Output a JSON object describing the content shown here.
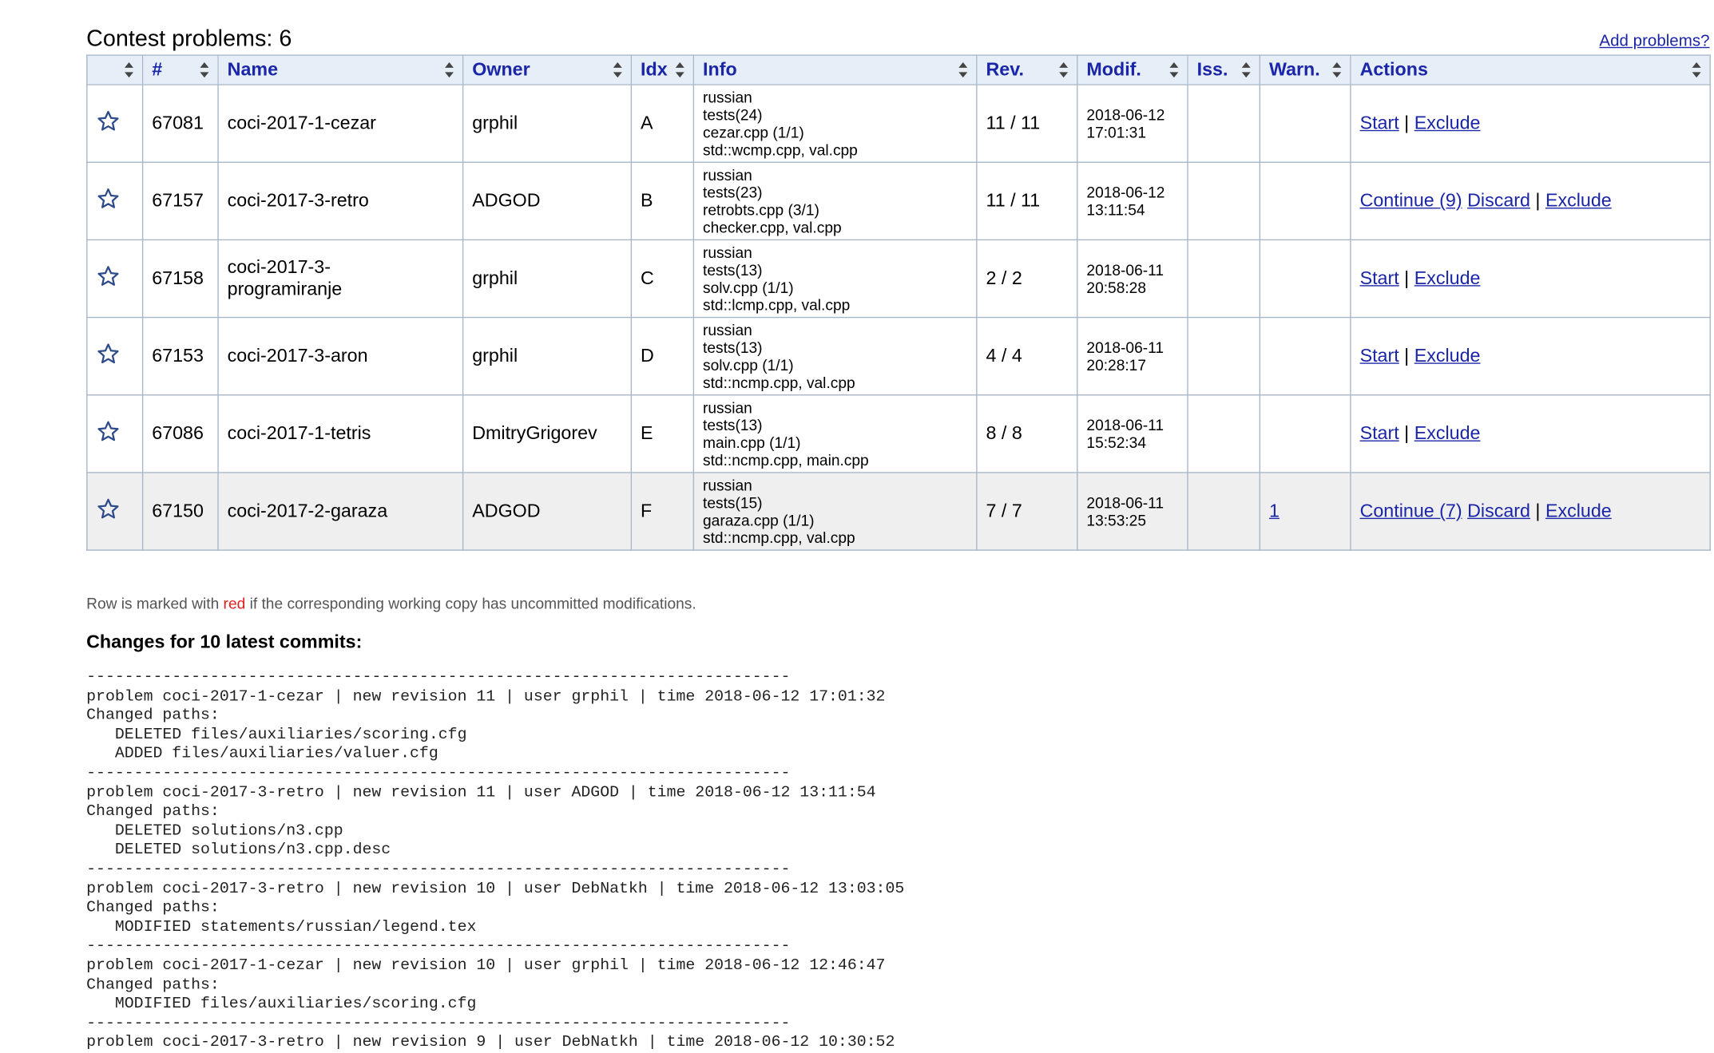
{
  "header": {
    "title": "Contest problems: 6",
    "add_link": "Add problems?"
  },
  "table": {
    "columns": [
      "",
      "#",
      "Name",
      "Owner",
      "Idx",
      "Info",
      "Rev.",
      "Modif.",
      "Iss.",
      "Warn.",
      "Actions"
    ],
    "rows": [
      {
        "id": "67081",
        "name": [
          "coci-2017-1-cezar"
        ],
        "owner": "grphil",
        "idx": "A",
        "info": [
          "russian",
          "tests(24)",
          "cezar.cpp (1/1)",
          "std::wcmp.cpp, val.cpp"
        ],
        "rev": "11 / 11",
        "modif": [
          "2018-06-12",
          "17:01:31"
        ],
        "iss": "",
        "warn": "",
        "actions": [
          {
            "label": "Start"
          },
          {
            "sep": "|"
          },
          {
            "label": "Exclude"
          }
        ]
      },
      {
        "id": "67157",
        "name": [
          "coci-2017-3-retro"
        ],
        "owner": "ADGOD",
        "idx": "B",
        "info": [
          "russian",
          "tests(23)",
          "retrobts.cpp (3/1)",
          "checker.cpp, val.cpp"
        ],
        "rev": "11 / 11",
        "modif": [
          "2018-06-12",
          "13:11:54"
        ],
        "iss": "",
        "warn": "",
        "actions": [
          {
            "label": "Continue (9)"
          },
          {
            "label": "Discard"
          },
          {
            "sep": "|"
          },
          {
            "label": "Exclude"
          }
        ]
      },
      {
        "id": "67158",
        "name": [
          "coci-2017-3-",
          "programiranje"
        ],
        "owner": "grphil",
        "idx": "C",
        "info": [
          "russian",
          "tests(13)",
          "solv.cpp (1/1)",
          "std::lcmp.cpp, val.cpp"
        ],
        "rev": "2 / 2",
        "modif": [
          "2018-06-11",
          "20:58:28"
        ],
        "iss": "",
        "warn": "",
        "actions": [
          {
            "label": "Start"
          },
          {
            "sep": "|"
          },
          {
            "label": "Exclude"
          }
        ]
      },
      {
        "id": "67153",
        "name": [
          "coci-2017-3-aron"
        ],
        "owner": "grphil",
        "idx": "D",
        "info": [
          "russian",
          "tests(13)",
          "solv.cpp (1/1)",
          "std::ncmp.cpp, val.cpp"
        ],
        "rev": "4 / 4",
        "modif": [
          "2018-06-11",
          "20:28:17"
        ],
        "iss": "",
        "warn": "",
        "actions": [
          {
            "label": "Start"
          },
          {
            "sep": "|"
          },
          {
            "label": "Exclude"
          }
        ]
      },
      {
        "id": "67086",
        "name": [
          "coci-2017-1-tetris"
        ],
        "owner": "DmitryGrigorev",
        "idx": "E",
        "info": [
          "russian",
          "tests(13)",
          "main.cpp (1/1)",
          "std::ncmp.cpp, main.cpp"
        ],
        "rev": "8 / 8",
        "modif": [
          "2018-06-11",
          "15:52:34"
        ],
        "iss": "",
        "warn": "",
        "actions": [
          {
            "label": "Start"
          },
          {
            "sep": "|"
          },
          {
            "label": "Exclude"
          }
        ]
      },
      {
        "id": "67150",
        "name": [
          "coci-2017-2-garaza"
        ],
        "owner": "ADGOD",
        "idx": "F",
        "info": [
          "russian",
          "tests(15)",
          "garaza.cpp (1/1)",
          "std::ncmp.cpp, val.cpp"
        ],
        "rev": "7 / 7",
        "modif": [
          "2018-06-11",
          "13:53:25"
        ],
        "iss": "",
        "warn": "1",
        "actions": [
          {
            "label": "Continue (7)"
          },
          {
            "label": "Discard"
          },
          {
            "sep": "|"
          },
          {
            "label": "Exclude"
          }
        ]
      }
    ]
  },
  "note": {
    "before": "Row is marked with ",
    "red_word": "red",
    "after": " if the corresponding working copy has uncommitted modifications."
  },
  "changes_title": "Changes for 10 latest commits:",
  "log_lines": [
    "--------------------------------------------------------------------------",
    "problem coci-2017-1-cezar | new revision 11 | user grphil | time 2018-06-12 17:01:32",
    "Changed paths:",
    "   DELETED files/auxiliaries/scoring.cfg",
    "   ADDED files/auxiliaries/valuer.cfg",
    "--------------------------------------------------------------------------",
    "problem coci-2017-3-retro | new revision 11 | user ADGOD | time 2018-06-12 13:11:54",
    "Changed paths:",
    "   DELETED solutions/n3.cpp",
    "   DELETED solutions/n3.cpp.desc",
    "--------------------------------------------------------------------------",
    "problem coci-2017-3-retro | new revision 10 | user DebNatkh | time 2018-06-12 13:03:05",
    "Changed paths:",
    "   MODIFIED statements/russian/legend.tex",
    "--------------------------------------------------------------------------",
    "problem coci-2017-1-cezar | new revision 10 | user grphil | time 2018-06-12 12:46:47",
    "Changed paths:",
    "   MODIFIED files/auxiliaries/scoring.cfg",
    "--------------------------------------------------------------------------",
    "problem coci-2017-3-retro | new revision 9 | user DebNatkh | time 2018-06-12 10:30:52"
  ],
  "colors": {
    "link": "#1a25a8",
    "header_bg": "#e6eef8",
    "border": "#a6b6c8",
    "alt_row": "#efefef",
    "red": "#e02020"
  },
  "icons": {
    "favourite": "star-outline-icon",
    "sort": "sort-arrows-icon"
  }
}
